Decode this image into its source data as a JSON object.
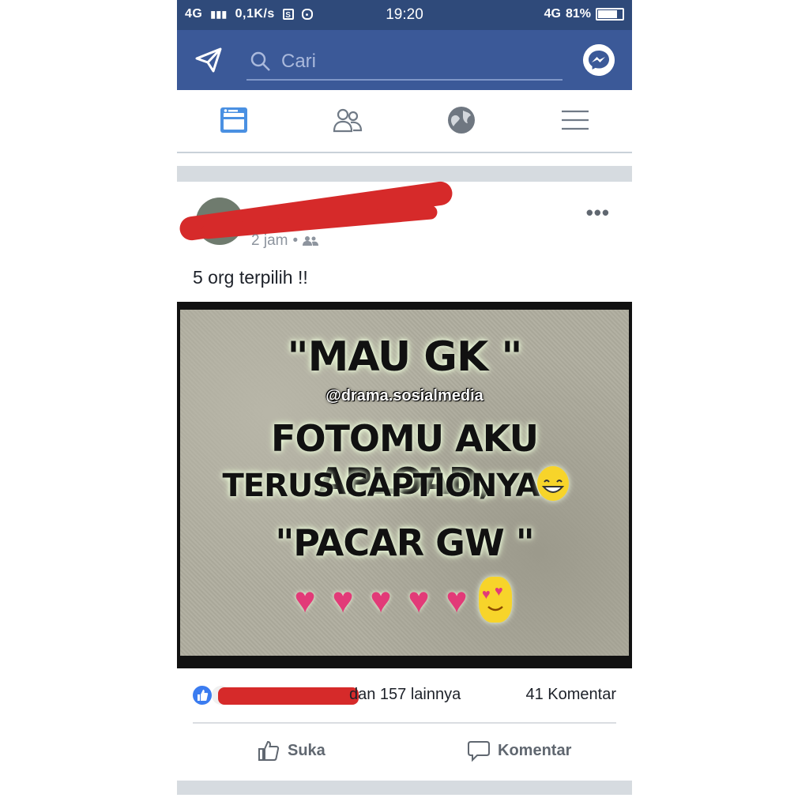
{
  "status_bar": {
    "network": "4G",
    "speed": "0,1K/s",
    "time": "19:20",
    "network_right": "4G",
    "battery": "81%",
    "battery_level": 0.81
  },
  "header": {
    "search_placeholder": "Cari",
    "icons": [
      "send-icon",
      "search-icon",
      "messenger-icon"
    ]
  },
  "nav": {
    "tabs": [
      "news-feed-icon",
      "friends-icon",
      "globe-icon",
      "menu-icon"
    ],
    "active": "news-feed-icon"
  },
  "post": {
    "time": "2 jam",
    "caption": "5 org terpilih !!",
    "image": {
      "line1": "\"MAU GK \"",
      "watermark": "@drama.sosialmedia",
      "line2": "FOTOMU AKU APLOAD,",
      "line3": "TERUS CAPTIONYA",
      "line4": "\"PACAR GW \""
    },
    "reactions_text": "dan 157 lainnya",
    "comments_text": "41 Komentar",
    "actions": {
      "like": "Suka",
      "comment": "Komentar"
    }
  },
  "colors": {
    "header_blue": "#3b5998",
    "status_blue": "#2f4a7a",
    "redaction_red": "#d62a2a"
  }
}
